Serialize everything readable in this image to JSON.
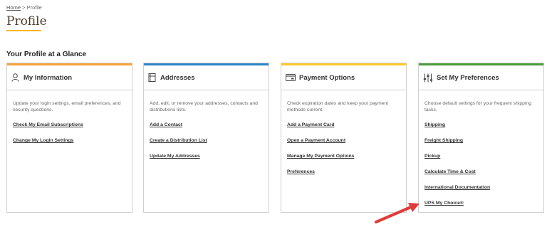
{
  "breadcrumb": {
    "home": "Home",
    "separator": " > ",
    "current": "Profile"
  },
  "page_title": "Profile",
  "section_heading": "Your Profile at a Glance",
  "colors": {
    "brand_gold": "#ffb500",
    "arrow_red": "#e03a3a"
  },
  "cards": [
    {
      "title": "My Information",
      "icon": "person-icon",
      "accent": "#f6a23c",
      "description": "Update your login settings, email preferences, and security questions.",
      "links": [
        "Check My Email Subscriptions",
        "Change My Login Settings"
      ]
    },
    {
      "title": "Addresses",
      "icon": "address-book-icon",
      "accent": "#2b85c7",
      "description": "Add, edit, or remove your addresses, contacts and distributions lists.",
      "links": [
        "Add a Contact",
        "Create a Distribution List",
        "Update My Addresses"
      ]
    },
    {
      "title": "Payment Options",
      "icon": "credit-card-icon",
      "accent": "#ffc82c",
      "description": "Check expiration dates and keep your payment methods current.",
      "links": [
        "Add a Payment Card",
        "Open a Payment Account",
        "Manage My Payment Options",
        "Preferences"
      ]
    },
    {
      "title": "Set My Preferences",
      "icon": "sliders-icon",
      "accent": "#4a9c3a",
      "description": "Choose default settings for your frequent shipping tasks.",
      "links": [
        "Shipping",
        "Freight Shipping",
        "Pickup",
        "Calculate Time & Cost",
        "International Documentation",
        "UPS My Choice®"
      ]
    }
  ]
}
